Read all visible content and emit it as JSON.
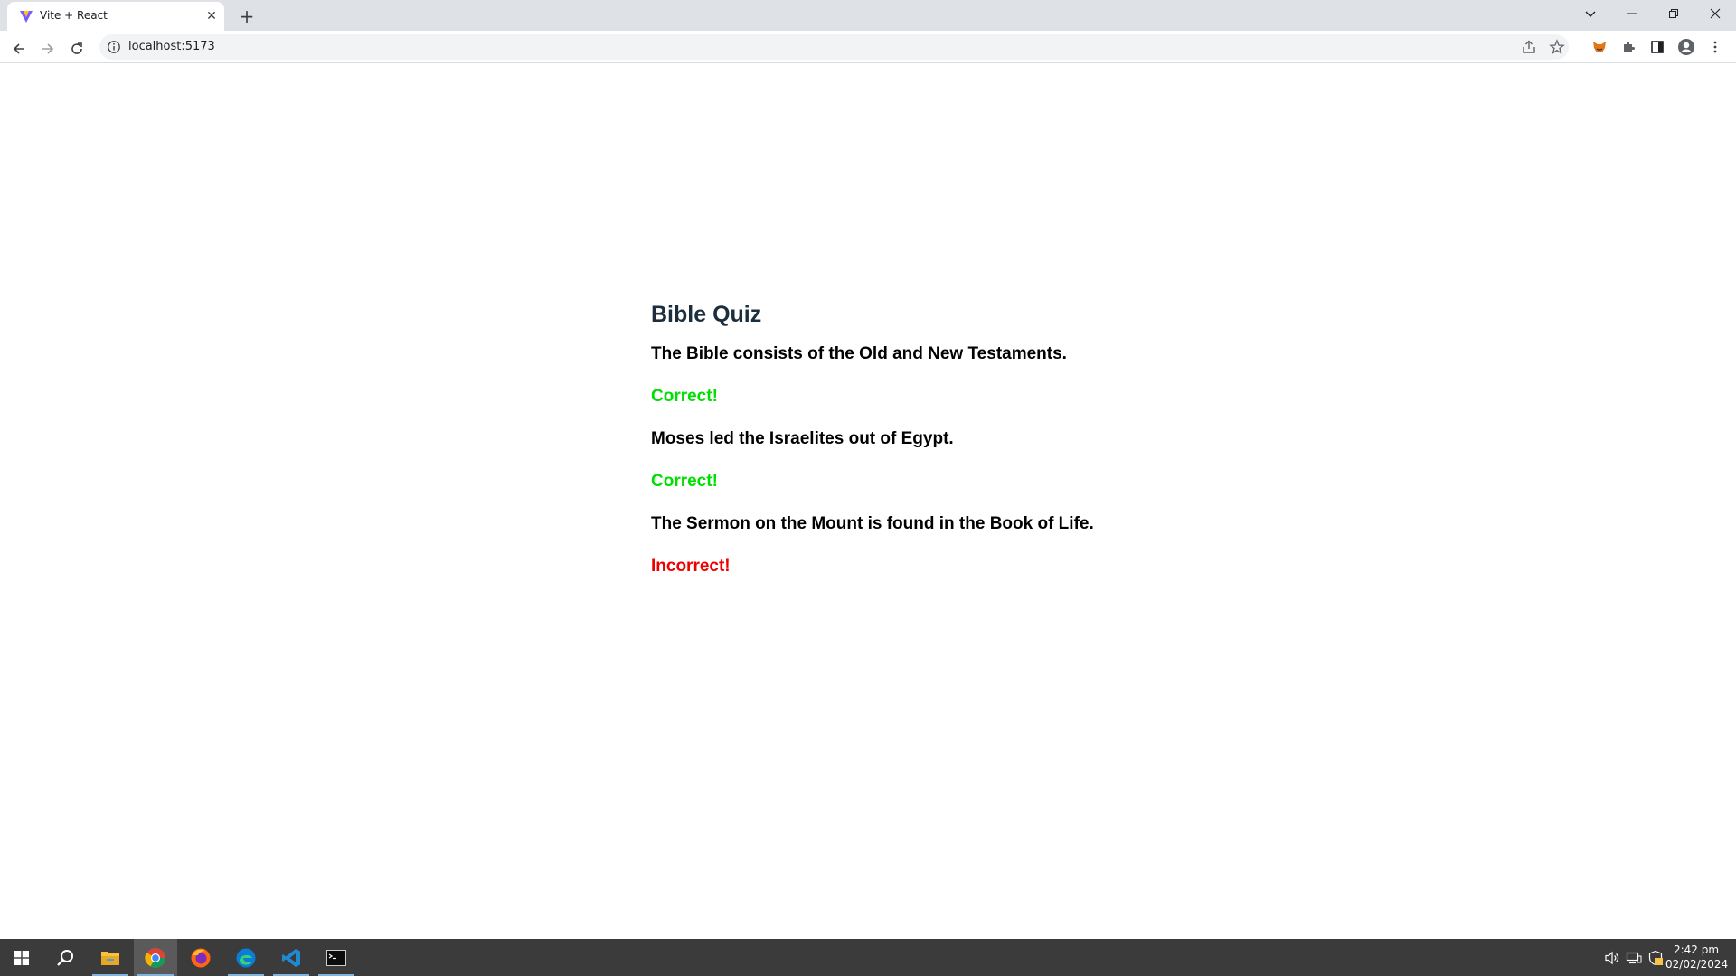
{
  "browser": {
    "tab_title": "Vite + React",
    "tab_close_glyph": "✕",
    "new_tab_glyph": "+",
    "url": "localhost:5173"
  },
  "quiz": {
    "title": "Bible Quiz",
    "items": [
      {
        "question": "The Bible consists of the Old and New Testaments.",
        "result": "Correct!",
        "status": "correct"
      },
      {
        "question": "Moses led the Israelites out of Egypt.",
        "result": "Correct!",
        "status": "correct"
      },
      {
        "question": "The Sermon on the Mount is found in the Book of Life.",
        "result": "Incorrect!",
        "status": "incorrect"
      }
    ]
  },
  "colors": {
    "title": "#1c2e3d",
    "correct": "#00e000",
    "incorrect": "#ee0000"
  },
  "taskbar": {
    "time": "2:42 pm",
    "date": "02/02/2024"
  }
}
